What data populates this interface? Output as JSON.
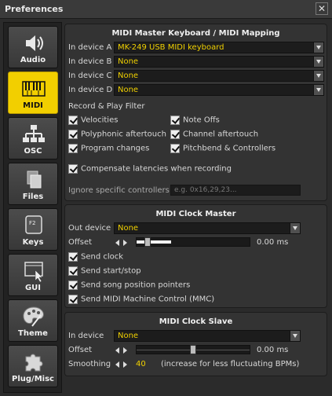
{
  "window": {
    "title": "Preferences",
    "close_glyph": "✕"
  },
  "sidebar": {
    "items": [
      {
        "label": "Audio",
        "icon": "speaker-icon",
        "active": false
      },
      {
        "label": "MIDI",
        "icon": "piano-keys-icon",
        "active": true
      },
      {
        "label": "OSC",
        "icon": "network-icon",
        "active": false
      },
      {
        "label": "Files",
        "icon": "files-icon",
        "active": false
      },
      {
        "label": "Keys",
        "icon": "keyboard-key-icon",
        "active": false
      },
      {
        "label": "GUI",
        "icon": "window-cursor-icon",
        "active": false
      },
      {
        "label": "Theme",
        "icon": "palette-icon",
        "active": false
      },
      {
        "label": "Plug/Misc",
        "icon": "puzzle-icon",
        "active": false
      }
    ],
    "keys_icon_text": "F2"
  },
  "midi_master": {
    "title": "MIDI Master Keyboard / MIDI Mapping",
    "devices": [
      {
        "label": "In device A",
        "value": "MK-249 USB MIDI keyboard"
      },
      {
        "label": "In device B",
        "value": "None"
      },
      {
        "label": "In device C",
        "value": "None"
      },
      {
        "label": "In device D",
        "value": "None"
      }
    ],
    "filter_title": "Record & Play Filter",
    "filters": [
      {
        "label": "Velocities",
        "checked": true
      },
      {
        "label": "Note Offs",
        "checked": true
      },
      {
        "label": "Polyphonic aftertouch",
        "checked": true
      },
      {
        "label": "Channel aftertouch",
        "checked": true
      },
      {
        "label": "Program changes",
        "checked": true
      },
      {
        "label": "Pitchbend & Controllers",
        "checked": true
      }
    ],
    "compensate": {
      "label": "Compensate latencies when recording",
      "checked": true
    },
    "ignore_label": "Ignore specific controllers",
    "ignore_placeholder": "e.g. 0x16,29,23..."
  },
  "clock_master": {
    "title": "MIDI Clock Master",
    "out_label": "Out device",
    "out_value": "None",
    "offset_label": "Offset",
    "offset_value": "0.00 ms",
    "offset_level": 0.0,
    "options": [
      {
        "label": "Send clock",
        "checked": true
      },
      {
        "label": "Send start/stop",
        "checked": true
      },
      {
        "label": "Send song position pointers",
        "checked": true
      },
      {
        "label": "Send MIDI Machine Control (MMC)",
        "checked": true
      }
    ]
  },
  "clock_slave": {
    "title": "MIDI Clock Slave",
    "in_label": "In device",
    "in_value": "None",
    "offset_label": "Offset",
    "offset_value": "0.00 ms",
    "offset_level": 0.0,
    "smoothing_label": "Smoothing",
    "smoothing_value": "40",
    "smoothing_hint": "(increase for less fluctuating BPMs)"
  },
  "colors": {
    "accent": "#f2cf00",
    "value_text": "#f0d000",
    "panel": "#333333"
  }
}
